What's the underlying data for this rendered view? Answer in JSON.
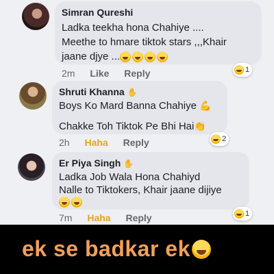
{
  "comments": [
    {
      "name": "Simran Qureshi",
      "lines": [
        "Ladka teekha hona  Chahiye ....",
        "Meethe to hmare tiktok stars ,,,Khair",
        "jaane djye ..."
      ],
      "time": "2m",
      "actions": [
        "Like",
        "Reply"
      ],
      "reaction_count": "1"
    },
    {
      "name": "Shruti Khanna",
      "lines": [
        "Boys Ko Mard Banna Chahiye",
        "Chakke Toh Tiktok Pe Bhi Hai"
      ],
      "time": "2h",
      "actions": [
        "Haha",
        "Reply"
      ],
      "reaction_count": "2"
    },
    {
      "name": "Er Piya Singh",
      "lines": [
        "Ladka Job Wala Hona Chahiyd",
        "Nalle to Tiktokers, Khair jaane dijiye"
      ],
      "time": "7m",
      "actions": [
        "Haha",
        "Reply"
      ],
      "reaction_count": "1"
    }
  ],
  "banner": {
    "text": "ek se badkar ek"
  },
  "colors": {
    "haha": "#e6a323",
    "banner_text": "#f3a05c",
    "bubble": "#e4e6eb"
  },
  "icons": [
    "laughing-emoji-icon",
    "waving-hand-icon",
    "flexed-biceps-icon",
    "clapping-hands-icon"
  ]
}
